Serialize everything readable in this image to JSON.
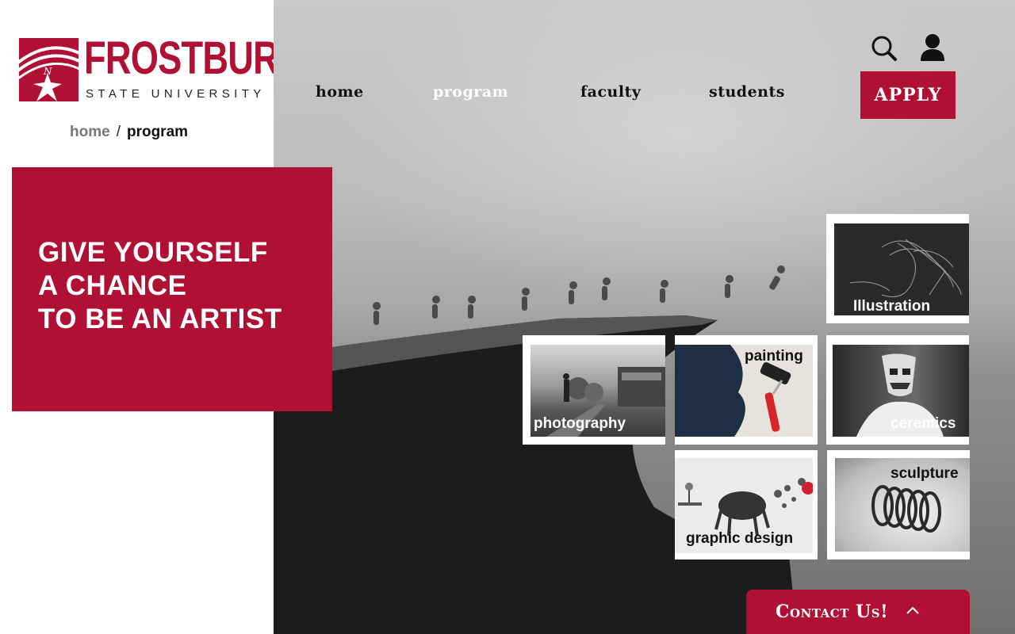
{
  "logo": {
    "wordmark": "FROSTBURG",
    "subtitle": "STATE UNIVERSITY",
    "emblem_letter": "N"
  },
  "breadcrumb": {
    "home": "home",
    "separator": "/",
    "current": "program"
  },
  "nav": {
    "items": [
      {
        "label": "home",
        "active": false
      },
      {
        "label": "program",
        "active": true
      },
      {
        "label": "faculty",
        "active": false
      },
      {
        "label": "students",
        "active": false
      }
    ],
    "apply": "APPLY"
  },
  "header_icons": [
    "search-icon",
    "user-icon"
  ],
  "headline": {
    "lines": [
      "GIVE YOURSELF",
      "A CHANCE",
      "TO BE AN ARTIST"
    ]
  },
  "tiles": [
    {
      "label": "Illustration"
    },
    {
      "label": "photography"
    },
    {
      "label": "painting"
    },
    {
      "label": "ceremics"
    },
    {
      "label": "graphic design"
    },
    {
      "label": "sculpture"
    }
  ],
  "contact": {
    "label": "Contact Us!"
  },
  "colors": {
    "brand": "#b01034",
    "nav_active": "#ffffff"
  }
}
